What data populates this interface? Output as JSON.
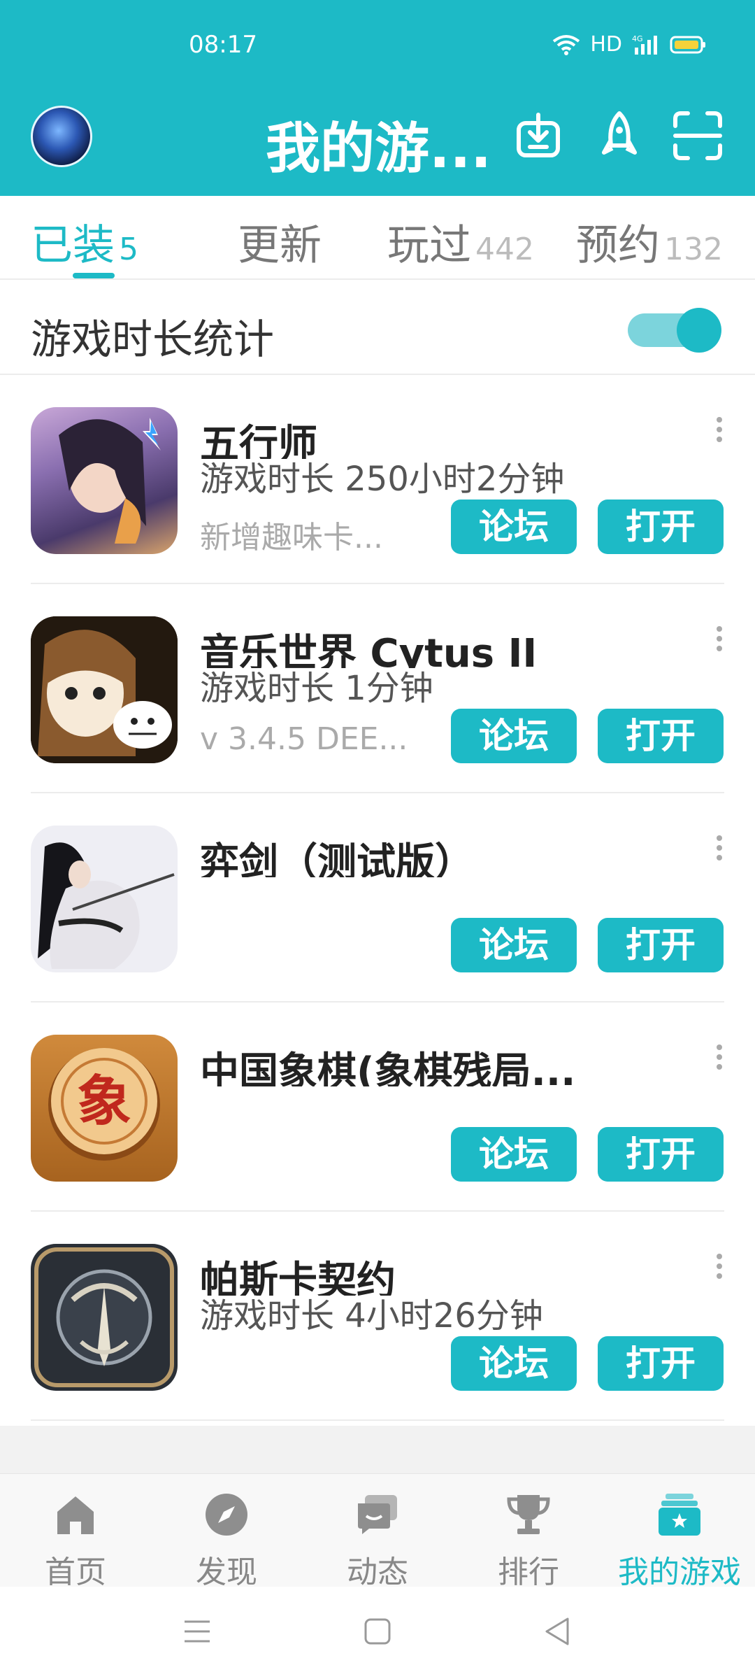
{
  "status_bar": {
    "time": "08:17",
    "network": "HD",
    "signal": "4G"
  },
  "header": {
    "title": "我的游...",
    "icons": [
      "download-icon",
      "rocket-icon",
      "scan-icon"
    ]
  },
  "tabs": [
    {
      "label": "已装",
      "count": "5"
    },
    {
      "label": "更新",
      "count": ""
    },
    {
      "label": "玩过",
      "count": "442"
    },
    {
      "label": "预约",
      "count": "132"
    }
  ],
  "stats": {
    "label": "游戏时长统计",
    "toggle_on": true
  },
  "games": [
    {
      "name": "五行师",
      "time": "游戏时长 250小时2分钟",
      "sub": "新增趣味卡...",
      "forum": "论坛",
      "open": "打开"
    },
    {
      "name": "音乐世界 Cytus II",
      "time": "游戏时长 1分钟",
      "sub": "v 3.4.5 DEE...",
      "forum": "论坛",
      "open": "打开"
    },
    {
      "name": "弈剑（测试版）",
      "time": "",
      "sub": "",
      "forum": "论坛",
      "open": "打开"
    },
    {
      "name": "中国象棋(象棋残局...",
      "time": "",
      "sub": "",
      "forum": "论坛",
      "open": "打开"
    },
    {
      "name": "帕斯卡契约",
      "time": "游戏时长 4小时26分钟",
      "sub": "",
      "forum": "论坛",
      "open": "打开"
    }
  ],
  "chess_glyph": "象",
  "bottom_nav": [
    {
      "label": "首页",
      "icon": "home-icon"
    },
    {
      "label": "发现",
      "icon": "compass-icon"
    },
    {
      "label": "动态",
      "icon": "chat-icon"
    },
    {
      "label": "排行",
      "icon": "trophy-icon"
    },
    {
      "label": "我的游戏",
      "icon": "my-games-icon",
      "active": true
    }
  ],
  "colors": {
    "accent": "#1dbac6"
  }
}
